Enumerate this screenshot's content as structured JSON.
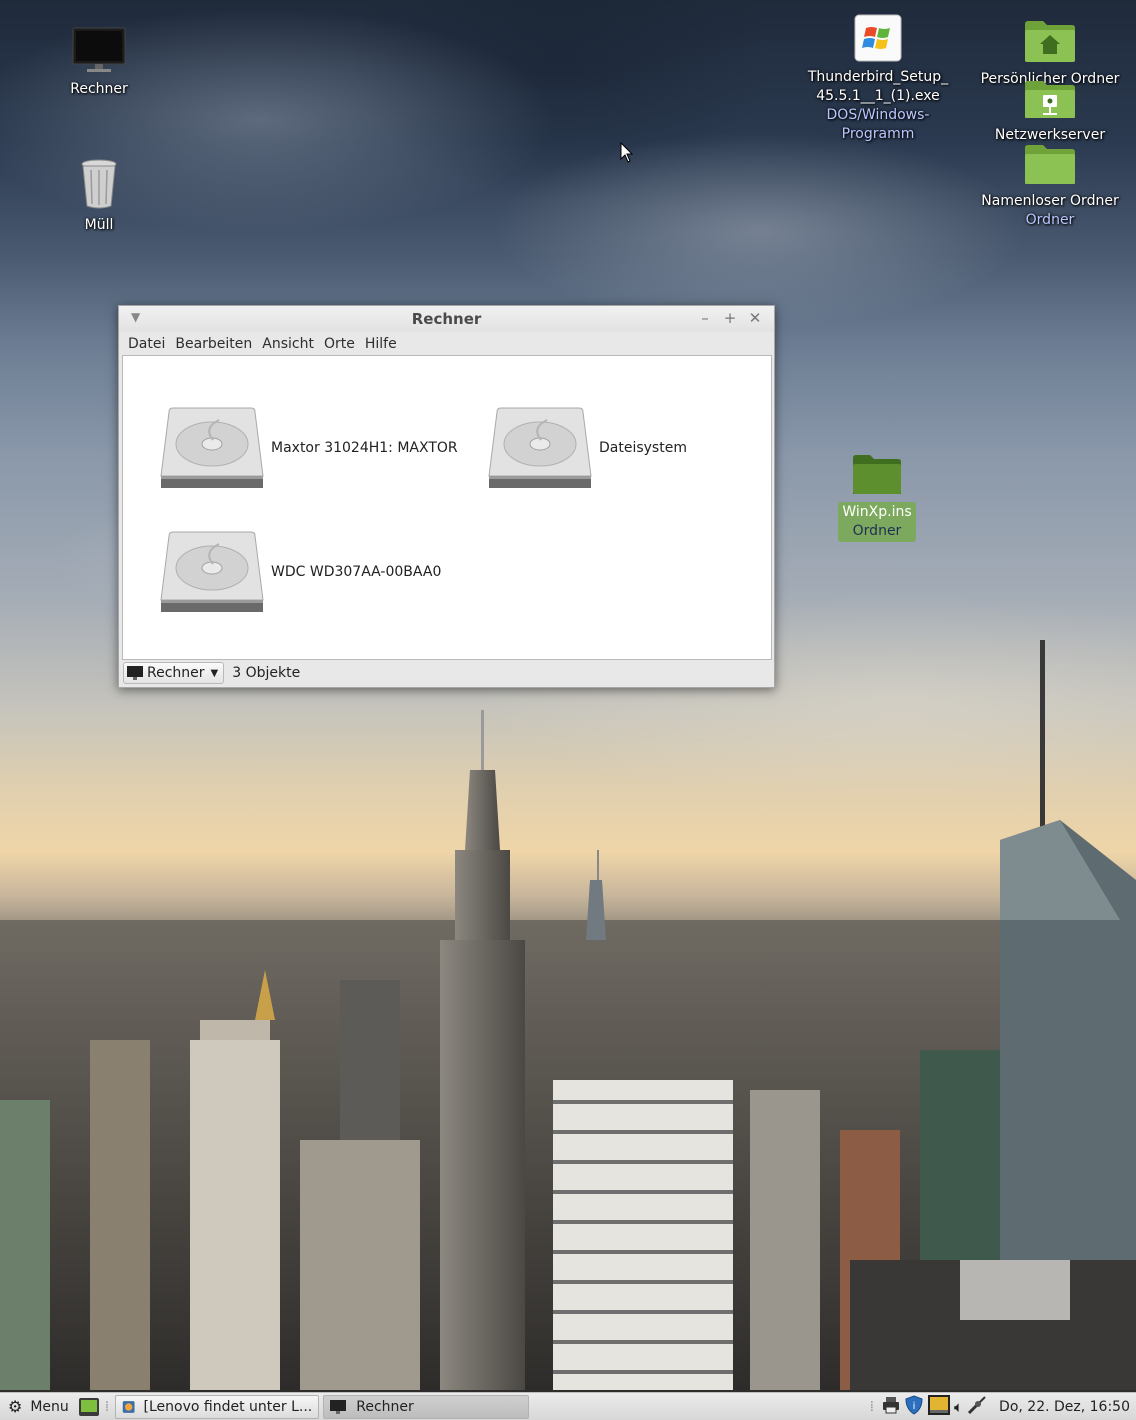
{
  "desktop": {
    "icons": {
      "rechner": {
        "label": "Rechner",
        "icon": "monitor-icon"
      },
      "muell": {
        "label": "Müll",
        "icon": "trash-icon"
      },
      "thunderbird": {
        "label_line1": "Thunderbird_Setup_",
        "label_line2": "45.5.1__1_(1).exe",
        "type_line1": "DOS/Windows-",
        "type_line2": "Programm",
        "icon": "windows-exe-icon"
      },
      "home": {
        "label": "Persönlicher Ordner",
        "icon": "home-folder-icon"
      },
      "network": {
        "label": "Netzwerkserver",
        "icon": "network-folder-icon"
      },
      "unnamed": {
        "label": "Namenloser Ordner",
        "type": "Ordner",
        "icon": "folder-icon"
      },
      "winxp": {
        "label": "WinXp.ins",
        "type": "Ordner",
        "icon": "folder-icon"
      }
    }
  },
  "window": {
    "title": "Rechner",
    "menu": [
      "Datei",
      "Bearbeiten",
      "Ansicht",
      "Orte",
      "Hilfe"
    ],
    "drives": [
      {
        "label": "Maxtor 31024H1: MAXTOR",
        "icon": "hard-drive-icon"
      },
      {
        "label": "Dateisystem",
        "icon": "hard-drive-icon"
      },
      {
        "label": "WDC WD307AA-00BAA0",
        "icon": "hard-drive-icon"
      }
    ],
    "status": {
      "location": "Rechner",
      "count": "3 Objekte"
    }
  },
  "taskbar": {
    "menu_label": "Menu",
    "tasks": [
      {
        "label": "[Lenovo findet unter L...",
        "active": false
      },
      {
        "label": "Rechner",
        "active": true
      }
    ],
    "clock": "Do, 22. Dez, 16:50"
  },
  "colors": {
    "window_bg": "#e8e8e8",
    "selection_green": "#78aa50",
    "folder_green": "#8cc153"
  }
}
